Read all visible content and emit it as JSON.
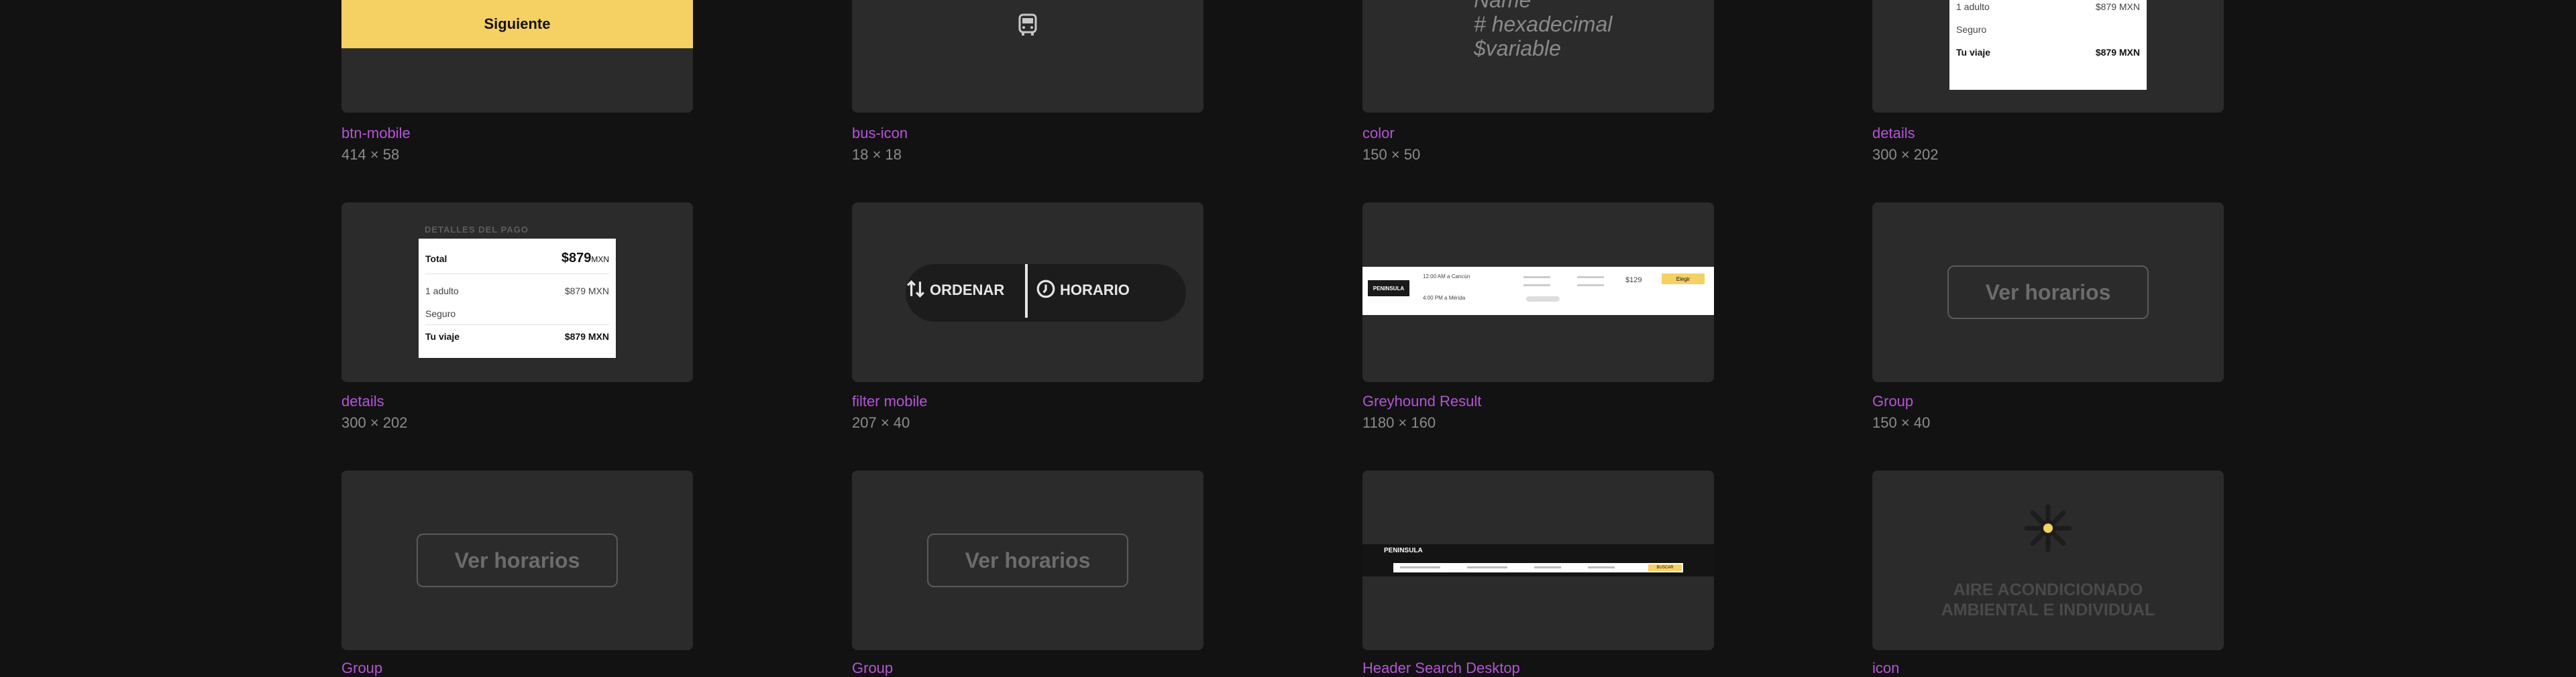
{
  "assets": [
    {
      "name": "btn-mobile",
      "dims": "414 × 58",
      "button_label": "Siguiente"
    },
    {
      "name": "bus-icon",
      "dims": "18 × 18",
      "icon": "bus-icon"
    },
    {
      "name": "color",
      "dims": "150 × 50",
      "lines": [
        "Name",
        "# hexadecimal",
        "$variable"
      ]
    },
    {
      "name": "details",
      "dims": "300 × 202",
      "rows": [
        {
          "label": "1 adulto",
          "value": "$879 MXN"
        },
        {
          "label": "Seguro",
          "value": ""
        },
        {
          "label": "Tu viaje",
          "value": "$879 MXN"
        }
      ]
    },
    {
      "name": "details",
      "dims": "300 × 202",
      "heading": "DETALLES DEL PAGO",
      "total_label": "Total",
      "total_amount": "$879",
      "total_currency": "MXN",
      "rows": [
        {
          "label": "1 adulto",
          "value": "$879 MXN"
        },
        {
          "label": "Seguro",
          "value": ""
        },
        {
          "label": "Tu viaje",
          "value": "$879 MXN"
        }
      ]
    },
    {
      "name": "filter mobile",
      "dims": "207 × 40",
      "sort_label": "ORDENAR",
      "schedule_label": "HORARIO"
    },
    {
      "name": "Greyhound Result",
      "dims": "1180 × 160",
      "logo": "PENINSULA",
      "price": "$129",
      "button": "Elegir",
      "row1": "12:00 AM a Cancún",
      "row2": "4:00 PM a Mérida"
    },
    {
      "name": "Group",
      "dims": "150 × 40",
      "button_label": "Ver horarios"
    },
    {
      "name": "Group",
      "dims": "",
      "button_label": "Ver horarios"
    },
    {
      "name": "Group",
      "dims": "",
      "button_label": "Ver horarios"
    },
    {
      "name": "Header Search Desktop",
      "dims": "",
      "logo": "PENINSULA",
      "button": "BUSCAR"
    },
    {
      "name": "icon",
      "dims": "",
      "caption_line1": "AIRE ACONDICIONADO",
      "caption_line2": "AMBIENTAL E INDIVIDUAL"
    }
  ],
  "colors": {
    "background": "#121212",
    "card": "#2b2b2b",
    "label": "#b455d6",
    "yellow": "#f5d063"
  }
}
